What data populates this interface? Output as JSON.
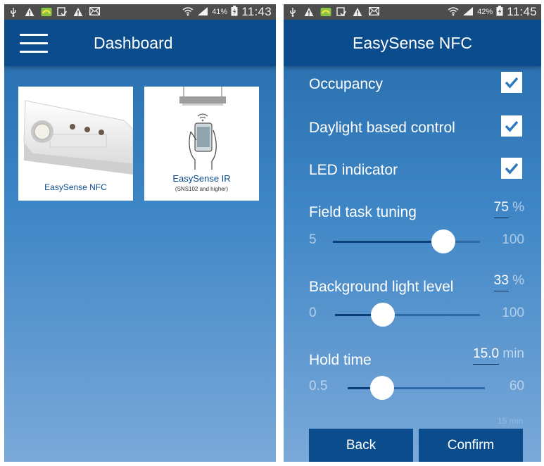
{
  "status_left": {
    "battery": "41%",
    "time": "11:43"
  },
  "status_right": {
    "battery": "42%",
    "time": "11:45"
  },
  "dashboard": {
    "title": "Dashboard",
    "tiles": [
      {
        "label": "EasySense NFC"
      },
      {
        "label": "EasySense IR",
        "sublabel": "(SNS102 and higher)"
      }
    ]
  },
  "nfc": {
    "title": "EasySense NFC",
    "options": [
      {
        "label": "Occupancy",
        "checked": true
      },
      {
        "label": "Daylight based control",
        "checked": true
      },
      {
        "label": "LED indicator",
        "checked": true
      }
    ],
    "field_task": {
      "label": "Field task tuning",
      "value": "75",
      "unit": "%",
      "min": "5",
      "max": "100",
      "level": 0.75
    },
    "background": {
      "label": "Background light level",
      "value": "33",
      "unit": "%",
      "min": "0",
      "max": "100",
      "level": 0.33
    },
    "hold_time": {
      "label": "Hold time",
      "value": "15.0",
      "unit": "min",
      "min": "0.5",
      "max": "60",
      "level": 0.25
    },
    "partial_next_value": "15 min",
    "back_label": "Back",
    "confirm_label": "Confirm"
  },
  "colors": {
    "appbar": "#0b4c8c",
    "statusbar": "#4d4d4d",
    "accent": "#0b4c8c"
  }
}
